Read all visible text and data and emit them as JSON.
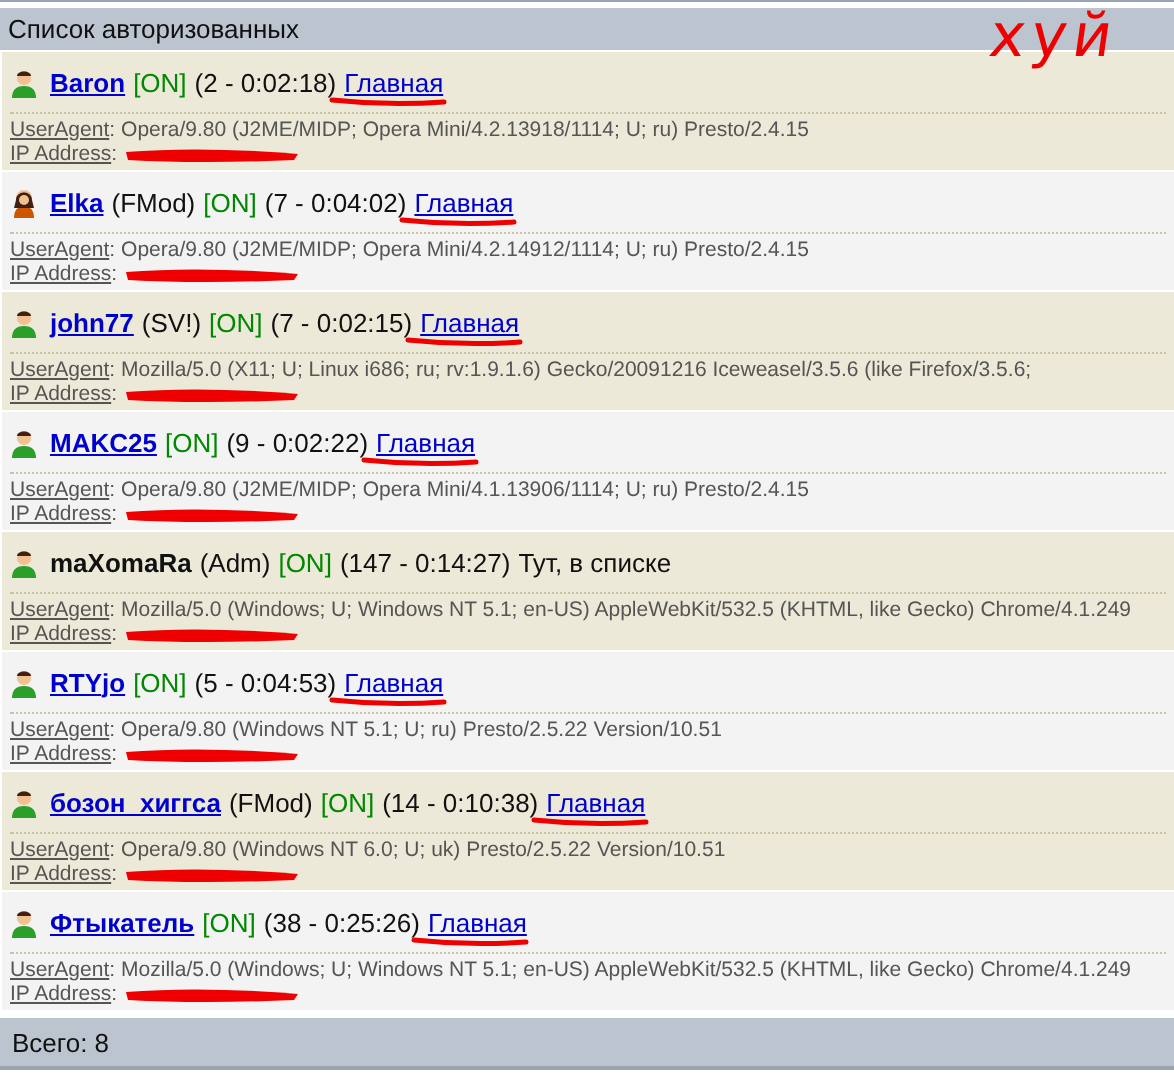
{
  "header": {
    "title": "Список авторизованных"
  },
  "scribble": {
    "text": "хуй"
  },
  "users": [
    {
      "name": "Baron",
      "linked": true,
      "kind": "male",
      "status": "[ON]",
      "session": "(2 - 0:02:18)",
      "location": "Главная",
      "location_link": true,
      "underlined": true,
      "ua_label": "UserAgent",
      "ua_sep": ":",
      "useragent": "Opera/9.80 (J2ME/MIDP; Opera Mini/4.2.13918/1114; U; ru) Presto/2.4.15",
      "ip_label": "IP Address",
      "ip_sep": ":"
    },
    {
      "name": "Elka",
      "linked": true,
      "kind": "female",
      "role": "(FMod)",
      "status": "[ON]",
      "session": "(7 - 0:04:02)",
      "location": "Главная",
      "location_link": true,
      "underlined": true,
      "ua_label": "UserAgent",
      "ua_sep": ":",
      "useragent": "Opera/9.80 (J2ME/MIDP; Opera Mini/4.2.14912/1114; U; ru) Presto/2.4.15",
      "ip_label": "IP Address",
      "ip_sep": ":"
    },
    {
      "name": "john77",
      "linked": true,
      "kind": "male",
      "role": "(SV!)",
      "status": "[ON]",
      "session": "(7 - 0:02:15)",
      "location": "Главная",
      "location_link": true,
      "underlined": true,
      "ua_label": "UserAgent",
      "ua_sep": ":",
      "useragent": "Mozilla/5.0 (X11; U; Linux i686; ru; rv:1.9.1.6) Gecko/20091216 Iceweasel/3.5.6 (like Firefox/3.5.6;",
      "ip_label": "IP Address",
      "ip_sep": ":"
    },
    {
      "name": "MAKC25",
      "linked": true,
      "kind": "male",
      "status": "[ON]",
      "session": "(9 - 0:02:22)",
      "location": "Главная",
      "location_link": true,
      "underlined": true,
      "ua_label": "UserAgent",
      "ua_sep": ":",
      "useragent": "Opera/9.80 (J2ME/MIDP; Opera Mini/4.1.13906/1114; U; ru) Presto/2.4.15",
      "ip_label": "IP Address",
      "ip_sep": ":"
    },
    {
      "name": "maXomaRa",
      "linked": false,
      "kind": "male",
      "role": "(Adm)",
      "status": "[ON]",
      "session": "(147 - 0:14:27)",
      "location": "Тут, в списке",
      "location_link": false,
      "underlined": false,
      "ua_label": "UserAgent",
      "ua_sep": ":",
      "useragent": "Mozilla/5.0 (Windows; U; Windows NT 5.1; en-US) AppleWebKit/532.5 (KHTML, like Gecko) Chrome/4.1.249",
      "ip_label": "IP Address",
      "ip_sep": ":"
    },
    {
      "name": "RTYjo",
      "linked": true,
      "kind": "male",
      "status": "[ON]",
      "session": "(5 - 0:04:53)",
      "location": "Главная",
      "location_link": true,
      "underlined": true,
      "ua_label": "UserAgent",
      "ua_sep": ":",
      "useragent": "Opera/9.80 (Windows NT 5.1; U; ru) Presto/2.5.22 Version/10.51",
      "ip_label": "IP Address",
      "ip_sep": ":"
    },
    {
      "name": "бозон_хиггса",
      "linked": true,
      "kind": "male",
      "role": "(FMod)",
      "status": "[ON]",
      "session": "(14 - 0:10:38)",
      "location": "Главная",
      "location_link": true,
      "underlined": true,
      "ua_label": "UserAgent",
      "ua_sep": ":",
      "useragent": "Opera/9.80 (Windows NT 6.0; U; uk) Presto/2.5.22 Version/10.51",
      "ip_label": "IP Address",
      "ip_sep": ":"
    },
    {
      "name": "Фтыкатель",
      "linked": true,
      "kind": "male",
      "status": "[ON]",
      "session": "(38 - 0:25:26)",
      "location": "Главная",
      "location_link": true,
      "underlined": true,
      "ua_label": "UserAgent",
      "ua_sep": ":",
      "useragent": "Mozilla/5.0 (Windows; U; Windows NT 5.1; en-US) AppleWebKit/532.5 (KHTML, like Gecko) Chrome/4.1.249",
      "ip_label": "IP Address",
      "ip_sep": ":"
    }
  ],
  "footer": {
    "total": "Всего: 8"
  }
}
